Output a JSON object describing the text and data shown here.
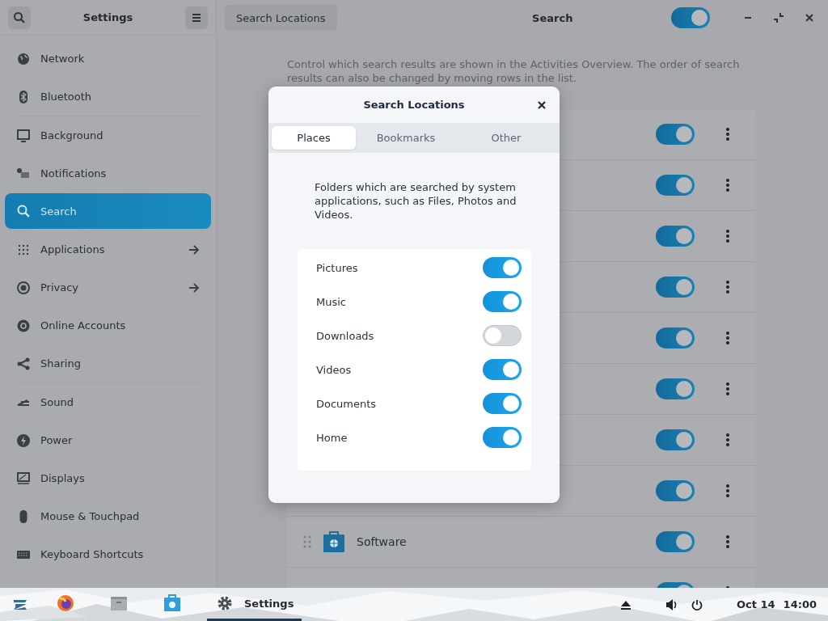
{
  "header": {
    "title": "Settings",
    "page_button": "Search Locations",
    "page_title": "Search",
    "search_enabled": true
  },
  "sidebar": {
    "sections": [
      {
        "items": [
          {
            "label": "Network",
            "selected": false,
            "arrow": false
          },
          {
            "label": "Bluetooth",
            "selected": false,
            "arrow": false
          }
        ]
      },
      {
        "items": [
          {
            "label": "Background",
            "selected": false,
            "arrow": false
          },
          {
            "label": "Notifications",
            "selected": false,
            "arrow": false
          },
          {
            "label": "Search",
            "selected": true,
            "arrow": false
          },
          {
            "label": "Applications",
            "selected": false,
            "arrow": true
          },
          {
            "label": "Privacy",
            "selected": false,
            "arrow": true
          },
          {
            "label": "Online Accounts",
            "selected": false,
            "arrow": false
          },
          {
            "label": "Sharing",
            "selected": false,
            "arrow": false
          }
        ]
      },
      {
        "items": [
          {
            "label": "Sound",
            "selected": false,
            "arrow": false
          },
          {
            "label": "Power",
            "selected": false,
            "arrow": false
          },
          {
            "label": "Displays",
            "selected": false,
            "arrow": false
          },
          {
            "label": "Mouse & Touchpad",
            "selected": false,
            "arrow": false
          },
          {
            "label": "Keyboard Shortcuts",
            "selected": false,
            "arrow": false
          }
        ]
      }
    ]
  },
  "description": "Control which search results are shown in the Activities Overview. The order of search results can also be changed by moving rows in the list.",
  "providers": [
    {
      "on": true
    },
    {
      "on": true
    },
    {
      "on": true
    },
    {
      "on": true
    },
    {
      "on": true
    },
    {
      "on": true
    },
    {
      "on": true
    },
    {
      "on": true
    },
    {
      "label": "Software",
      "on": true
    },
    {
      "on": true
    }
  ],
  "dialog": {
    "title": "Search Locations",
    "tabs": [
      {
        "label": "Places",
        "selected": true
      },
      {
        "label": "Bookmarks",
        "selected": false
      },
      {
        "label": "Other",
        "selected": false
      }
    ],
    "description": "Folders which are searched by system applications, such as Files, Photos and Videos.",
    "locations": [
      {
        "label": "Pictures",
        "on": true
      },
      {
        "label": "Music",
        "on": true
      },
      {
        "label": "Downloads",
        "on": false
      },
      {
        "label": "Videos",
        "on": true
      },
      {
        "label": "Documents",
        "on": true
      },
      {
        "label": "Home",
        "on": true
      }
    ]
  },
  "taskbar": {
    "apps": [
      {
        "selected": false
      },
      {
        "selected": false
      },
      {
        "selected": false
      },
      {
        "label": "Settings",
        "selected": true
      }
    ],
    "date": "Oct 14",
    "time": "14:00"
  }
}
